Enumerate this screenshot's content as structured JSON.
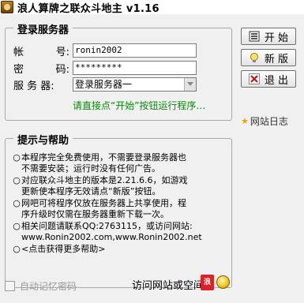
{
  "window": {
    "title": "浪人算牌之联众斗地主 v1.16"
  },
  "login_group": {
    "title": "登录服务器",
    "account_label": [
      "帐",
      "号:"
    ],
    "account_value": "ronin2002",
    "password_label": [
      "密",
      "码:"
    ],
    "password_value": "*********",
    "server_label": [
      "服 务 器:"
    ],
    "server_value": "登录服务器一",
    "hint": "请直接点“开始”按钮运行程序…"
  },
  "buttons": {
    "start": "开 始",
    "new": "新 版",
    "exit": "退 出",
    "log": "网站日志"
  },
  "help_group": {
    "title": "提示与帮助",
    "items": [
      "本程序完全免费使用，不需要登录服务器也\n不需要安装；运行时没有任何广告。",
      "对应联众斗地主的版本是2.21.6.6，如游戏\n更新使本程序无效请点“新版”按钮。",
      "网吧可将程序仅放在服务器上共享使用，程\n序升级时仅需在服务器重新下载一次。",
      "相关问题请联系QQ:2763115，或访问网站:\nwww.Ronin2002.com,www.Ronin2002.net",
      "<点击获得更多帮助>"
    ]
  },
  "bottom": {
    "remember_label": "自动记忆密码",
    "visit_label": "访问网站或空间",
    "red_icon_text": "浪"
  }
}
